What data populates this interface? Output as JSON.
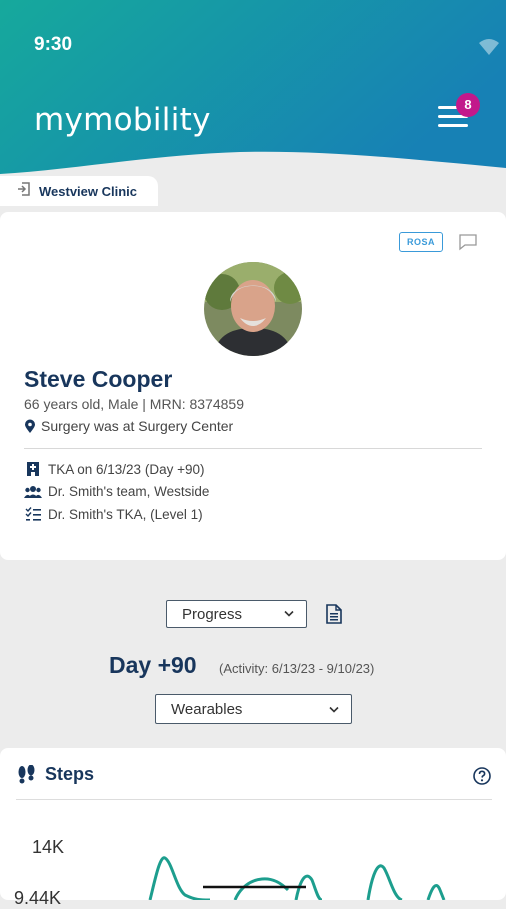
{
  "status_bar": {
    "time": "9:30"
  },
  "header": {
    "logo": "mymobility",
    "menu_badge": "8"
  },
  "clinic_tab": {
    "label": "Westview Clinic"
  },
  "patient": {
    "badge": "ROSA",
    "name": "Steve Cooper",
    "details": "66 years old,  Male | MRN: 8374859",
    "location": "Surgery was at Surgery Center",
    "procedure": "TKA on 6/13/23 (Day +90)",
    "team": "Dr. Smith's team, Westside",
    "protocol": "Dr. Smith's TKA, (Level 1)"
  },
  "controls": {
    "view_select": "Progress",
    "day_label": "Day +90",
    "activity_range": "(Activity:  6/13/23 - 9/10/23)",
    "data_select": "Wearables"
  },
  "steps_card": {
    "title": "Steps",
    "y_ticks": [
      "14K",
      "9.44K"
    ]
  },
  "colors": {
    "brand_teal": "#1aa3a0",
    "navy": "#18365c",
    "badge_magenta": "#c2188b",
    "chart_line": "#1d9e8e"
  },
  "icons": {
    "menu": "hamburger-icon",
    "clinic": "login-arrow-icon",
    "flag": "comment-flag-icon",
    "location": "map-pin-icon",
    "procedure": "hospital-icon",
    "team": "group-icon",
    "protocol": "checklist-icon",
    "document": "document-icon",
    "steps": "footprints-icon",
    "help": "question-circle-icon"
  }
}
